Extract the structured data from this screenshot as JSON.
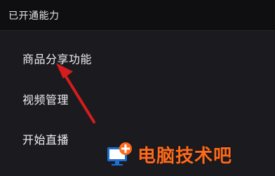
{
  "header": {
    "title": "已开通能力"
  },
  "menu": {
    "items": [
      {
        "label": "商品分享功能"
      },
      {
        "label": "视频管理"
      },
      {
        "label": "开始直播"
      }
    ]
  },
  "annotation": {
    "arrow_color": "#d61c1c"
  },
  "watermark": {
    "text": "电脑技术吧",
    "icon": "computer-plus-logo-icon",
    "text_color": "#ff6a1a"
  }
}
